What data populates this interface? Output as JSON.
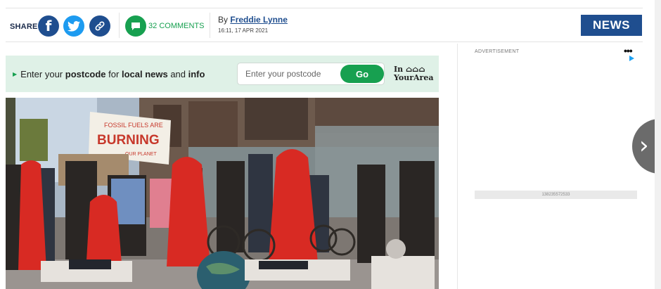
{
  "share": {
    "label": "SHARE",
    "facebook_icon": "facebook-icon",
    "twitter_icon": "twitter-icon",
    "link_icon": "link-icon"
  },
  "comments": {
    "count": "32",
    "label": "COMMENTS"
  },
  "byline": {
    "prefix": "By",
    "author": "Freddie Lynne",
    "timestamp": "16:11, 17 APR 2021"
  },
  "section_button": "NEWS",
  "postcode": {
    "text_1": "Enter your ",
    "text_2": "postcode",
    "text_3": " for ",
    "text_4": "local news",
    "text_5": " and ",
    "text_6": "info",
    "placeholder": "Enter your postcode",
    "go_label": "Go",
    "brand_line1": "In",
    "brand_line2": "YourArea"
  },
  "photo": {
    "banner_line1": "FOSSIL FUELS ARE",
    "banner_line2": "BURNING",
    "banner_line3": "OUR PLANET"
  },
  "ad": {
    "label": "ADVERTISEMENT",
    "dots": "•••",
    "strip_id": "138235572533"
  },
  "colors": {
    "brand_blue": "#1f4e8f",
    "accent_green": "#17a050",
    "twitter_blue": "#1d9bf0"
  }
}
